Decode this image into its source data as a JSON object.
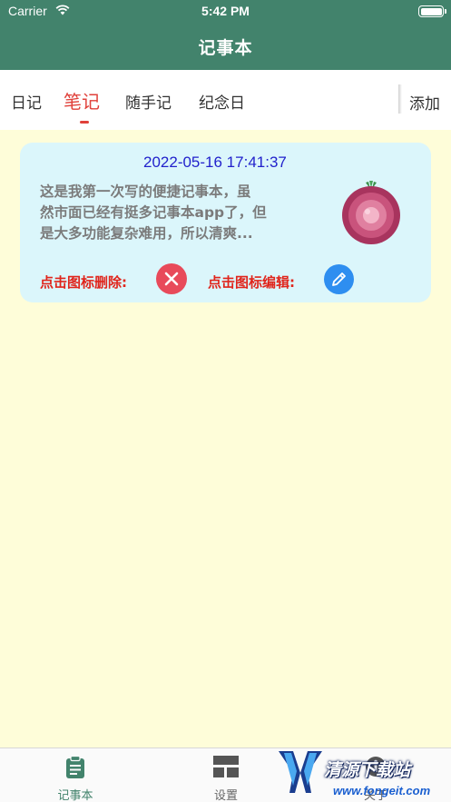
{
  "status_bar": {
    "carrier": "Carrier",
    "time": "5:42 PM"
  },
  "header": {
    "title": "记事本"
  },
  "tabs": [
    {
      "label": "日记",
      "active": false
    },
    {
      "label": "笔记",
      "active": true
    },
    {
      "label": "随手记",
      "active": false
    },
    {
      "label": "纪念日",
      "active": false
    }
  ],
  "add_label": "添加",
  "note": {
    "date": "2022-05-16 17:41:37",
    "text_lines": [
      "这是我第一次写的便捷记事本，虽",
      "然市面已经有挺多记事本app了，但",
      "是大多功能复杂难用，所以清爽..."
    ],
    "icon": "onion-icon",
    "delete_label": "点击图标删除:",
    "edit_label": "点击图标编辑:"
  },
  "bottom_nav": [
    {
      "label": "记事本",
      "icon": "clipboard-icon",
      "active": true
    },
    {
      "label": "设置",
      "icon": "grid-icon",
      "active": false
    },
    {
      "label": "关于",
      "icon": "info-icon",
      "active": false
    }
  ],
  "watermark": {
    "text": "清源下载站",
    "url": "www.fongeit.com"
  },
  "colors": {
    "header_bg": "#42836c",
    "page_bg": "#fefdd9",
    "card_bg": "#dbf6fb",
    "accent_red": "#e0403a",
    "date_blue": "#2222cc",
    "delete_red": "#e84a5a",
    "edit_blue": "#2e8ef0"
  }
}
